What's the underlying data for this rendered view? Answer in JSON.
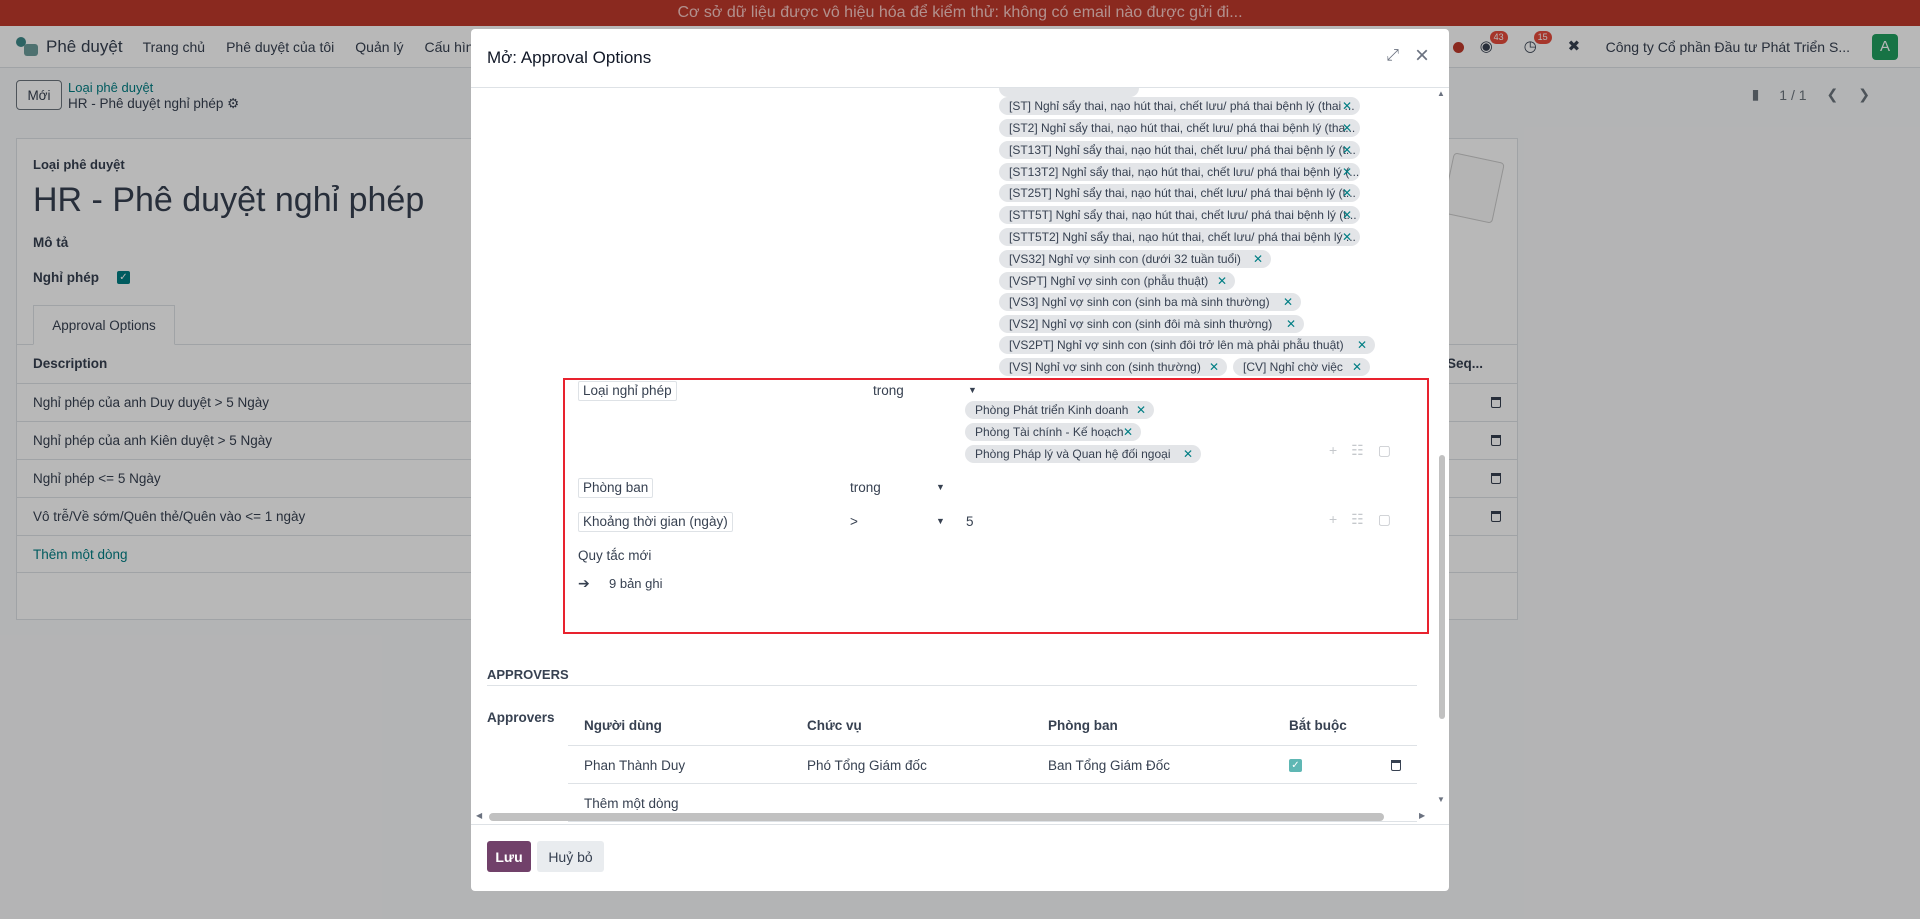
{
  "banner": "Cơ sở dữ liệu được vô hiệu hóa để kiểm thử: không có email nào được gửi đi...",
  "navbar": {
    "app_name": "Phê duyệt",
    "menu": [
      "Trang chủ",
      "Phê duyệt của tôi",
      "Quản lý",
      "Cấu hìn"
    ],
    "messages_count": "43",
    "activities_count": "15",
    "company": "Công ty Cổ phần Đầu tư Phát Triển S...",
    "avatar_letter": "A"
  },
  "control": {
    "new_button": "Mới",
    "breadcrumb_parent": "Loại phê duyệt",
    "breadcrumb_current": "HR - Phê duyệt nghỉ phép",
    "pager": "1 / 1"
  },
  "form": {
    "type_label": "Loại phê duyệt",
    "title": "HR - Phê duyệt nghỉ phép",
    "description_label": "Mô tả",
    "leave_label": "Nghỉ phép",
    "tab_label": "Approval Options",
    "table_header": "Description",
    "table_header_right": "Seq...",
    "rows": [
      "Nghỉ phép của anh Duy duyệt > 5 Ngày",
      "Nghỉ phép của anh Kiên duyệt > 5 Ngày",
      "Nghỉ phép <= 5 Ngày",
      "Vô trễ/Về sớm/Quên thẻ/Quên vào <= 1 ngày"
    ],
    "add_line": "Thêm một dòng"
  },
  "modal": {
    "title": "Mở: Approval Options",
    "leave_type_tags": [
      "[ST] Nghỉ sẩy thai, nạo hút thai, chết lưu/ phá thai bệnh lý (thai ...",
      "[ST2] Nghỉ sẩy thai, nạo hút thai, chết lưu/ phá thai bệnh lý (tha...",
      "[ST13T] Nghỉ sẩy thai, nạo hút thai, chết lưu/ phá thai bệnh lý (t...",
      "[ST13T2] Nghỉ sẩy thai, nạo hút thai, chết lưu/ phá thai bệnh lý (...",
      "[ST25T] Nghỉ sẩy thai, nạo hút thai, chết lưu/ phá thai bệnh lý (t...",
      "[STT5T] Nghỉ sẩy thai, nạo hút thai, chết lưu/ phá thai bệnh lý (t...",
      "[STT5T2] Nghỉ sẩy thai, nạo hút thai, chết lưu/ phá thai bệnh lý ...",
      "[VS32] Nghỉ vợ sinh con (dưới 32 tuần tuổi)",
      "[VSPT] Nghỉ vợ sinh con (phẫu thuật)",
      "[VS3] Nghỉ vợ sinh con (sinh ba mà sinh thường)",
      "[VS2] Nghỉ vợ sinh con (sinh đôi mà sinh thường)",
      "[VS2PT] Nghỉ vợ sinh con (sinh đôi trở lên mà phải phẫu thuật)",
      "[VS] Nghỉ vợ sinh con (sinh thường)",
      "[CV] Nghỉ chờ việc"
    ],
    "rule1_field": "Loại nghỉ phép",
    "rule1_op": "trong",
    "department_tags": [
      "Phòng Phát triển Kinh doanh",
      "Phòng Tài chính - Kế hoạch",
      "Phòng Pháp lý và Quan hệ đối ngoại"
    ],
    "rule2_field": "Phòng ban",
    "rule2_op": "trong",
    "rule3_field": "Khoảng thời gian (ngày)",
    "rule3_op": ">",
    "rule3_value": "5",
    "new_rule": "Quy tắc mới",
    "records": "9 bản ghi",
    "approvers_section": "APPROVERS",
    "approvers_label": "Approvers",
    "approvers_headers": [
      "Người dùng",
      "Chức vụ",
      "Phòng ban",
      "Bắt buộc"
    ],
    "approver": {
      "user": "Phan Thành Duy",
      "position": "Phó Tổng Giám đốc",
      "department": "Ban Tổng Giám Đốc"
    },
    "add_line": "Thêm một dòng",
    "save": "Lưu",
    "cancel": "Huỷ bỏ"
  }
}
